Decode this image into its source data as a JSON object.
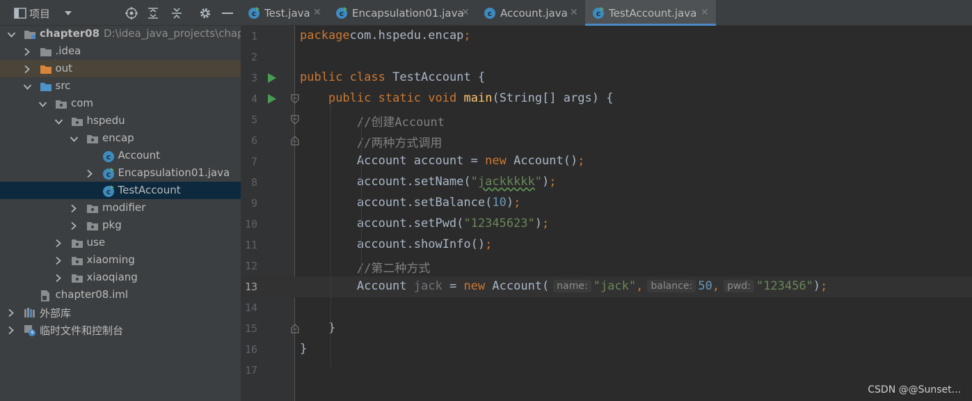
{
  "project_panel": {
    "title": "项目",
    "tree": [
      {
        "label": "chapter08",
        "path": "D:\\idea_java_projects\\chapte",
        "kind": "module",
        "expand": "open",
        "highlight": ""
      },
      {
        "label": ".idea",
        "kind": "folder-gray",
        "expand": "closed",
        "highlight": ""
      },
      {
        "label": "out",
        "kind": "folder-orange",
        "expand": "closed",
        "highlight": "out"
      },
      {
        "label": "src",
        "kind": "folder-blue",
        "expand": "open",
        "highlight": ""
      },
      {
        "label": "com",
        "kind": "package",
        "expand": "open",
        "highlight": ""
      },
      {
        "label": "hspedu",
        "kind": "package",
        "expand": "open",
        "highlight": ""
      },
      {
        "label": "encap",
        "kind": "package",
        "expand": "open",
        "highlight": ""
      },
      {
        "label": "Account",
        "kind": "class",
        "expand": "none",
        "highlight": ""
      },
      {
        "label": "Encapsulation01.java",
        "kind": "class-run",
        "expand": "closed",
        "highlight": ""
      },
      {
        "label": "TestAccount",
        "kind": "class-run",
        "expand": "none",
        "highlight": "selected"
      },
      {
        "label": "modifier",
        "kind": "package",
        "expand": "closed",
        "highlight": ""
      },
      {
        "label": "pkg",
        "kind": "package",
        "expand": "closed",
        "highlight": ""
      },
      {
        "label": "use",
        "kind": "package",
        "expand": "closed",
        "highlight": ""
      },
      {
        "label": "xiaoming",
        "kind": "package",
        "expand": "closed",
        "highlight": ""
      },
      {
        "label": "xiaoqiang",
        "kind": "package",
        "expand": "closed",
        "highlight": ""
      },
      {
        "label": "chapter08.iml",
        "kind": "iml",
        "expand": "none",
        "highlight": ""
      },
      {
        "label": "外部库",
        "kind": "libraries",
        "expand": "closed",
        "highlight": ""
      },
      {
        "label": "临时文件和控制台",
        "kind": "scratches",
        "expand": "closed",
        "highlight": ""
      }
    ]
  },
  "tabs": [
    {
      "label": "Test.java",
      "icon": "java-class-run-icon",
      "active": false
    },
    {
      "label": "Encapsulation01.java",
      "icon": "java-class-run-icon",
      "active": false
    },
    {
      "label": "Account.java",
      "icon": "java-class-icon",
      "active": false
    },
    {
      "label": "TestAccount.java",
      "icon": "java-class-run-icon",
      "active": true
    }
  ],
  "editor": {
    "current_line": 13,
    "lines": [
      {
        "num": "1",
        "tokens": [
          [
            "kw",
            "package"
          ],
          [
            "",
            "com.hspedu.encap"
          ],
          [
            "kw",
            ";"
          ]
        ]
      },
      {
        "num": "2",
        "tokens": []
      },
      {
        "num": "3",
        "run": true,
        "tokens": [
          [
            "kw",
            "public"
          ],
          [
            "",
            " "
          ],
          [
            "kw",
            "class"
          ],
          [
            "",
            " TestAccount {"
          ]
        ]
      },
      {
        "num": "4",
        "run": true,
        "fold": "start",
        "tokens": [
          [
            "",
            "    "
          ],
          [
            "kw",
            "public"
          ],
          [
            "",
            " "
          ],
          [
            "kw",
            "static"
          ],
          [
            "",
            " "
          ],
          [
            "kw",
            "void"
          ],
          [
            "",
            " "
          ],
          [
            "fn",
            "main"
          ],
          [
            "",
            "(String[] args) {"
          ]
        ]
      },
      {
        "num": "5",
        "fold": "start",
        "tokens": [
          [
            "",
            "        "
          ],
          [
            "cmt",
            "//创建Account"
          ]
        ]
      },
      {
        "num": "6",
        "fold": "end",
        "tokens": [
          [
            "",
            "        "
          ],
          [
            "cmt",
            "//两种方式调用"
          ]
        ]
      },
      {
        "num": "7",
        "tokens": [
          [
            "",
            "        Account account = "
          ],
          [
            "kw",
            "new"
          ],
          [
            "",
            " Account()"
          ],
          [
            "kw",
            ";"
          ]
        ]
      },
      {
        "num": "8",
        "tokens": [
          [
            "",
            "        account.setName("
          ],
          [
            "str",
            "\""
          ],
          [
            "strw",
            "jackkkkk"
          ],
          [
            "str",
            "\""
          ],
          [
            "",
            ")"
          ],
          [
            "kw",
            ";"
          ]
        ]
      },
      {
        "num": "9",
        "tokens": [
          [
            "",
            "        account.setBalance("
          ],
          [
            "num",
            "10"
          ],
          [
            "",
            ")"
          ],
          [
            "kw",
            ";"
          ]
        ]
      },
      {
        "num": "10",
        "tokens": [
          [
            "",
            "        account.setPwd("
          ],
          [
            "str",
            "\"12345623\""
          ],
          [
            "",
            ")"
          ],
          [
            "kw",
            ";"
          ]
        ]
      },
      {
        "num": "11",
        "tokens": [
          [
            "",
            "        account.showInfo()"
          ],
          [
            "kw",
            ";"
          ]
        ]
      },
      {
        "num": "12",
        "tokens": [
          [
            "",
            "        "
          ],
          [
            "cmt",
            "//第二种方式"
          ]
        ]
      },
      {
        "num": "13",
        "tokens": [
          [
            "",
            "        Account "
          ],
          [
            "unused",
            "jack"
          ],
          [
            "",
            " = "
          ],
          [
            "kw",
            "new"
          ],
          [
            "",
            " Account("
          ],
          [
            "hint",
            "name:"
          ],
          [
            "str",
            "\"jack\""
          ],
          [
            "kw",
            ","
          ],
          [
            "hint",
            "balance:"
          ],
          [
            "num",
            "50"
          ],
          [
            "kw",
            ","
          ],
          [
            "hint",
            "pwd:"
          ],
          [
            "str",
            "\"123456\""
          ],
          [
            "",
            ")"
          ],
          [
            "kw",
            ";"
          ]
        ]
      },
      {
        "num": "14",
        "tokens": []
      },
      {
        "num": "15",
        "fold": "end",
        "tokens": [
          [
            "",
            "    }"
          ]
        ]
      },
      {
        "num": "16",
        "tokens": [
          [
            "",
            "}"
          ]
        ]
      },
      {
        "num": "17",
        "tokens": []
      }
    ]
  },
  "watermark": "CSDN @@Sunset...",
  "colors": {
    "keyword": "#cc7832",
    "string": "#6a8759",
    "number": "#6897bb",
    "comment": "#808080",
    "method": "#ffc66d",
    "text": "#a9b7c6",
    "accent": "#4a88c7"
  }
}
